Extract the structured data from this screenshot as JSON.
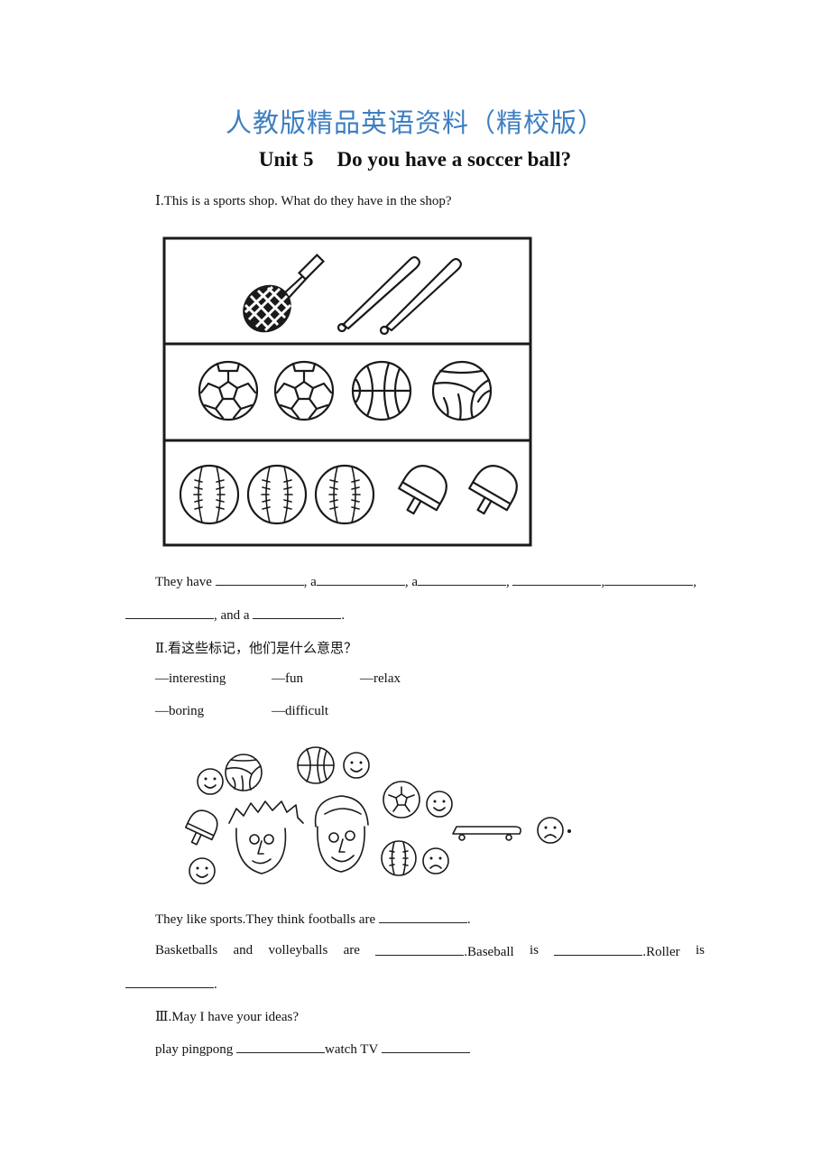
{
  "header": {
    "banner": "人教版精品英语资料（精校版）",
    "unit": "Unit 5",
    "title": "Do you have a soccer ball?"
  },
  "section1": {
    "heading": "Ⅰ.This is a sports shop. What do they have in the shop?",
    "picture": {
      "rows": [
        [
          "tennis-racket",
          "baseball-bat",
          "baseball-bat"
        ],
        [
          "soccer-ball",
          "soccer-ball",
          "basketball",
          "volleyball"
        ],
        [
          "baseball",
          "baseball",
          "baseball",
          "ping-pong-paddle",
          "ping-pong-paddle"
        ]
      ]
    },
    "sentence": {
      "p1": "They have ",
      "p2": ", a",
      "p3": ", a",
      "p4": ", ",
      "p5": ",",
      "p6": ",",
      "p7": ", and a ",
      "p8": "."
    }
  },
  "section2": {
    "heading": "Ⅱ.看这些标记，他们是什么意思？",
    "legend": [
      {
        "mark": "—",
        "label": "interesting"
      },
      {
        "mark": "—",
        "label": "fun"
      },
      {
        "mark": "—",
        "label": "relax"
      },
      {
        "mark": "—",
        "label": "boring"
      },
      {
        "mark": "—",
        "label": "difficult"
      }
    ],
    "picture": {
      "items": [
        {
          "object": "volleyball",
          "face": "smile"
        },
        {
          "object": "basketball",
          "face": "smile"
        },
        {
          "object": "soccer-ball",
          "face": "smile"
        },
        {
          "object": "ping-pong-paddle",
          "face": "smile"
        },
        {
          "object": "baseball",
          "face": "frown"
        },
        {
          "object": "skateboard",
          "face": "frown"
        }
      ],
      "characters": [
        "boy-spiky-hair",
        "boy-smiling"
      ]
    },
    "line1": {
      "p1": "They like sports.They think footballs are ",
      "p2": "."
    },
    "line2": {
      "w1": "Basketballs",
      "w2": "and",
      "w3": "volleyballs",
      "w4": "are",
      "w5": ".Baseball",
      "w6": "is",
      "w7": ".Roller",
      "w8": "is"
    },
    "line3": {
      "p1": "."
    }
  },
  "section3": {
    "heading": "Ⅲ.May I have your ideas?",
    "line": {
      "p1": "play pingpong ",
      "p2": "watch TV "
    }
  }
}
